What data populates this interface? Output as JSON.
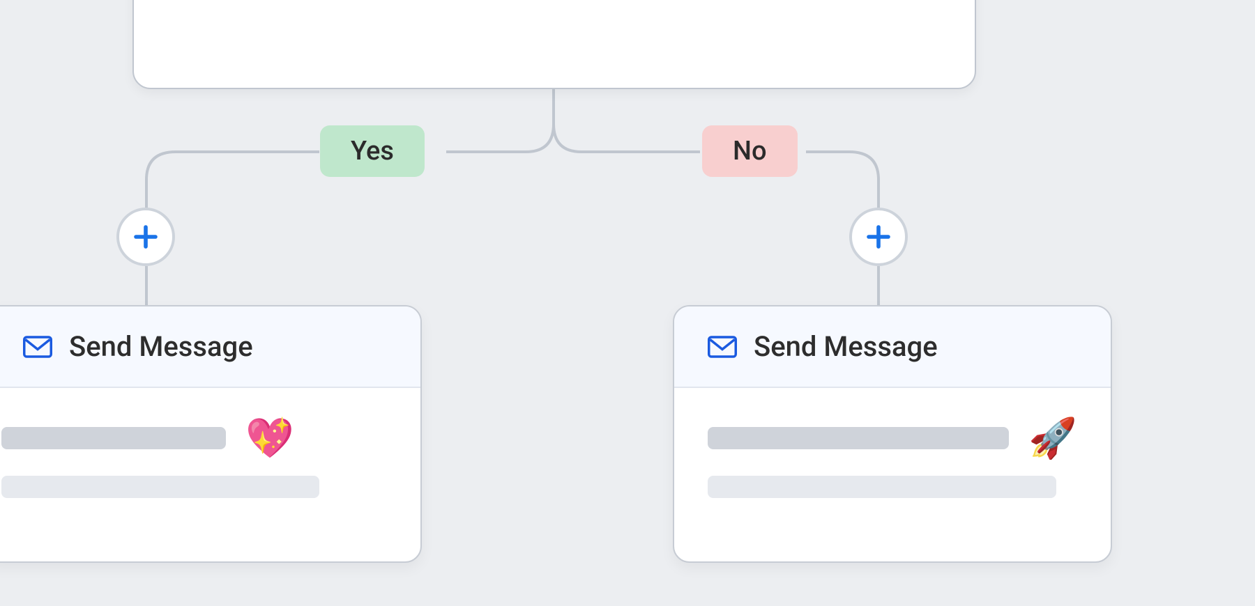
{
  "flow": {
    "branches": {
      "yes": {
        "label": "Yes",
        "color": "#bfe7cc"
      },
      "no": {
        "label": "No",
        "color": "#f8cfcf"
      }
    },
    "add_button_icon": "plus-icon",
    "cards": {
      "left": {
        "icon": "mail-icon",
        "title": "Send Message",
        "emoji": "💖"
      },
      "right": {
        "icon": "mail-icon",
        "title": "Send Message",
        "emoji": "🚀"
      }
    }
  }
}
